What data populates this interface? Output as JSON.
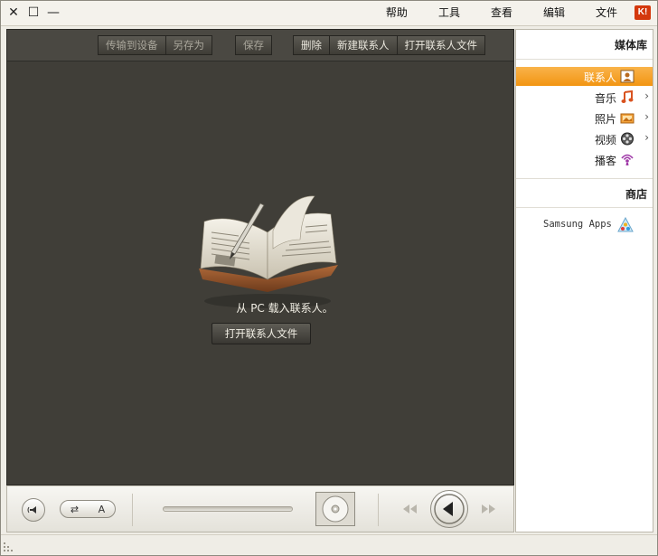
{
  "window": {
    "app_logo": "K!",
    "controls": {
      "close": "✕",
      "restore": "☐",
      "minimize": "—"
    }
  },
  "menu": {
    "items": [
      {
        "label": "文件"
      },
      {
        "label": "编辑"
      },
      {
        "label": "查看"
      },
      {
        "label": "工具"
      },
      {
        "label": "帮助"
      }
    ]
  },
  "toolbar": {
    "open_contacts": "打开联系人文件",
    "new_contact": "新建联系人",
    "delete": "删除",
    "save": "保存",
    "save_as": "另存为",
    "transfer_to_device": "传输到设备"
  },
  "main": {
    "prompt": "从 PC 载入联系人。",
    "open_button": "打开联系人文件"
  },
  "sidebar": {
    "library_header": "媒体库",
    "items": [
      {
        "label": "联系人",
        "icon": "contacts-icon",
        "active": true
      },
      {
        "label": "音乐",
        "icon": "music-icon",
        "has_children": true
      },
      {
        "label": "照片",
        "icon": "photos-icon",
        "has_children": true
      },
      {
        "label": "视频",
        "icon": "video-icon",
        "has_children": true
      },
      {
        "label": "播客",
        "icon": "podcast-icon"
      }
    ],
    "store_header": "商店",
    "store_item": "Samsung Apps"
  },
  "player": {
    "shuffle_label": "⇄",
    "repeat_label": "A"
  },
  "colors": {
    "accent": "#f29512",
    "content_bg": "#403e38",
    "logo_red": "#d4380d"
  }
}
